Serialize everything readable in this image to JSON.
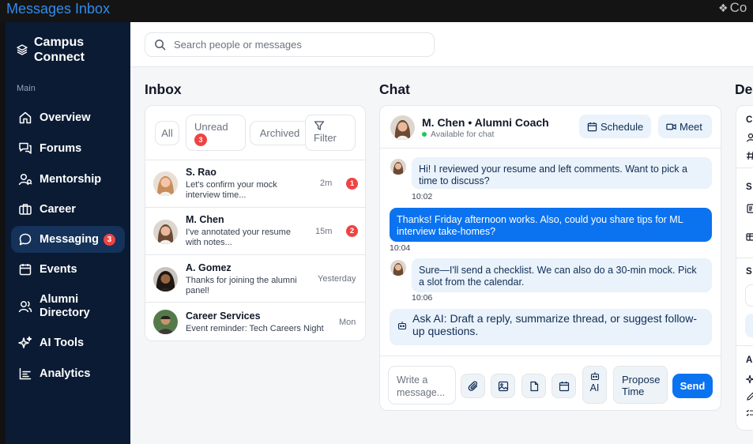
{
  "window": {
    "title": "Messages Inbox",
    "right_label": "Co"
  },
  "sidebar": {
    "brand": "Campus Connect",
    "section_label": "Main",
    "items": [
      {
        "label": "Overview",
        "icon": "home-icon"
      },
      {
        "label": "Forums",
        "icon": "forum-icon"
      },
      {
        "label": "Mentorship",
        "icon": "mentor-icon"
      },
      {
        "label": "Career",
        "icon": "briefcase-icon"
      },
      {
        "label": "Messaging",
        "icon": "chat-icon",
        "badge": "3",
        "active": true
      },
      {
        "label": "Events",
        "icon": "calendar-icon"
      },
      {
        "label": "Alumni Directory",
        "icon": "people-icon"
      },
      {
        "label": "AI Tools",
        "icon": "sparkle-icon"
      },
      {
        "label": "Analytics",
        "icon": "chart-icon"
      }
    ]
  },
  "search": {
    "placeholder": "Search people or messages"
  },
  "inbox": {
    "title": "Inbox",
    "filters": {
      "all": "All",
      "unread": "Unread",
      "unread_count": "3",
      "archived": "Archived",
      "filter": "Filter"
    },
    "conversations": [
      {
        "name": "S. Rao",
        "preview": "Let's confirm your mock interview time...",
        "time": "2m",
        "unread": "1"
      },
      {
        "name": "M. Chen",
        "preview": "I've annotated your resume with notes...",
        "time": "15m",
        "unread": "2"
      },
      {
        "name": "A. Gomez",
        "preview": "Thanks for joining the alumni panel!",
        "time": "Yesterday",
        "unread": ""
      },
      {
        "name": "Career Services",
        "preview": "Event reminder: Tech Careers Night",
        "time": "Mon",
        "unread": ""
      }
    ]
  },
  "chat": {
    "title": "Chat",
    "contact_name": "M. Chen • Alumni Coach",
    "status": "Available for chat",
    "schedule_label": "Schedule",
    "meet_label": "Meet",
    "messages": [
      {
        "from": "them",
        "text": "Hi! I reviewed your resume and left comments. Want to pick a time to discuss?",
        "time": "10:02"
      },
      {
        "from": "me",
        "text": "Thanks! Friday afternoon works. Also, could you share tips for ML interview take-homes?",
        "time": "10:04"
      },
      {
        "from": "them",
        "text": "Sure—I'll send a checklist. We can also do a 30-min mock. Pick a slot from the calendar.",
        "time": "10:06"
      }
    ],
    "ai_suggestion": "Ask AI: Draft a reply, summarize thread, or suggest follow-up questions.",
    "composer": {
      "placeholder": "Write a message...",
      "ai_label": "AI",
      "propose_label": "Propose Time",
      "send_label": "Send"
    }
  },
  "details": {
    "title": "De",
    "section_labels": [
      "C",
      "S",
      "S",
      "A"
    ]
  },
  "colors": {
    "accent": "#0b73f0",
    "sidebar_bg": "#0b1b34",
    "badge": "#ef4444",
    "bubble_in": "#eaf2fb"
  }
}
